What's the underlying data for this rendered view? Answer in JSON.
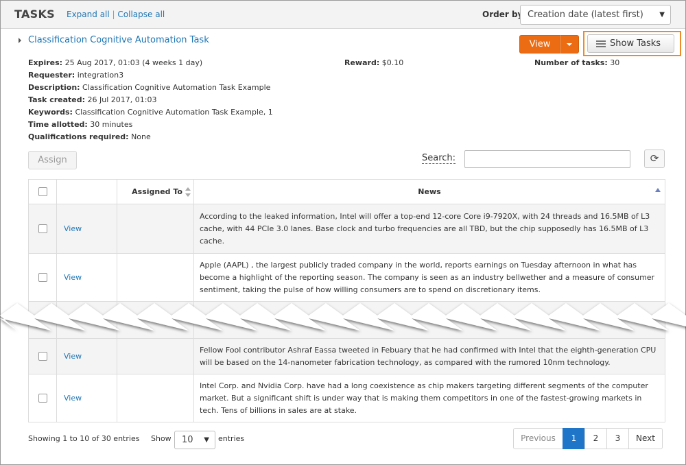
{
  "header": {
    "title": "TASKS",
    "expand_all": "Expand all",
    "separator": "|",
    "collapse_all": "Collapse all",
    "order_by_label": "Order by:",
    "order_by_value": "Creation date (latest first)"
  },
  "task": {
    "name": "Classification Cognitive Automation Task",
    "view_label": "View",
    "show_tasks_label": "Show Tasks",
    "expires_label": "Expires:",
    "expires_value": "25 Aug 2017, 01:03 (4 weeks 1 day)",
    "reward_label": "Reward:",
    "reward_value": "$0.10",
    "num_tasks_label": "Number of tasks:",
    "num_tasks_value": "30",
    "requester_label": "Requester:",
    "requester_value": "integration3",
    "description_label": "Description:",
    "description_value": "Classification Cognitive Automation Task Example",
    "created_label": "Task created:",
    "created_value": "26 Jul 2017, 01:03",
    "keywords_label": "Keywords:",
    "keywords_value": "Classification Cognitive Automation Task Example, 1",
    "time_label": "Time allotted:",
    "time_value": "30 minutes",
    "qual_label": "Qualifications required:",
    "qual_value": "None"
  },
  "toolbar": {
    "assign_label": "Assign",
    "search_label": "Search:",
    "search_value": ""
  },
  "table": {
    "headers": {
      "assigned_to": "Assigned To",
      "news": "News"
    },
    "rows": [
      {
        "view": "View",
        "assigned": "",
        "news": "According to the leaked information, Intel will offer a top-end 12-core Core i9-7920X, with 24 threads and 16.5MB of L3 cache, with 44 PCIe 3.0 lanes. Base clock and turbo frequencies are all TBD, but the chip supposedly has 16.5MB of L3 cache."
      },
      {
        "view": "View",
        "assigned": "",
        "news": "Apple (AAPL) , the largest publicly traded company in the world, reports earnings on Tuesday afternoon in what has become a highlight of the reporting season. The company is seen as an industry bellwether and a measure of consumer sentiment, taking the pulse of how willing consumers are to spend on discretionary items."
      },
      {
        "view": "View",
        "assigned": "",
        "news": "Fellow Fool contributor Ashraf Eassa tweeted in Febuary that he had confirmed with Intel that the eighth-generation CPU will be based on the 14-nanometer fabrication technology, as compared with the rumored 10nm technology."
      },
      {
        "view": "View",
        "assigned": "",
        "news": "Intel Corp. and Nvidia Corp. have had a long coexistence as chip makers targeting different segments of the computer market. But a significant shift is under way that is making them competitors in one of the fastest-growing markets in tech. Tens of billions in sales are at stake."
      }
    ]
  },
  "footer": {
    "showing": "Showing 1 to 10 of 30 entries",
    "show_label": "Show",
    "entries_value": "10",
    "entries_label": "entries",
    "pagination": {
      "previous": "Previous",
      "pages": [
        "1",
        "2",
        "3"
      ],
      "next": "Next"
    }
  },
  "colors": {
    "accent_orange": "#eb6c13",
    "highlight": "#f08a24",
    "link_blue": "#1f76b5",
    "active_page": "#1f76c9"
  }
}
